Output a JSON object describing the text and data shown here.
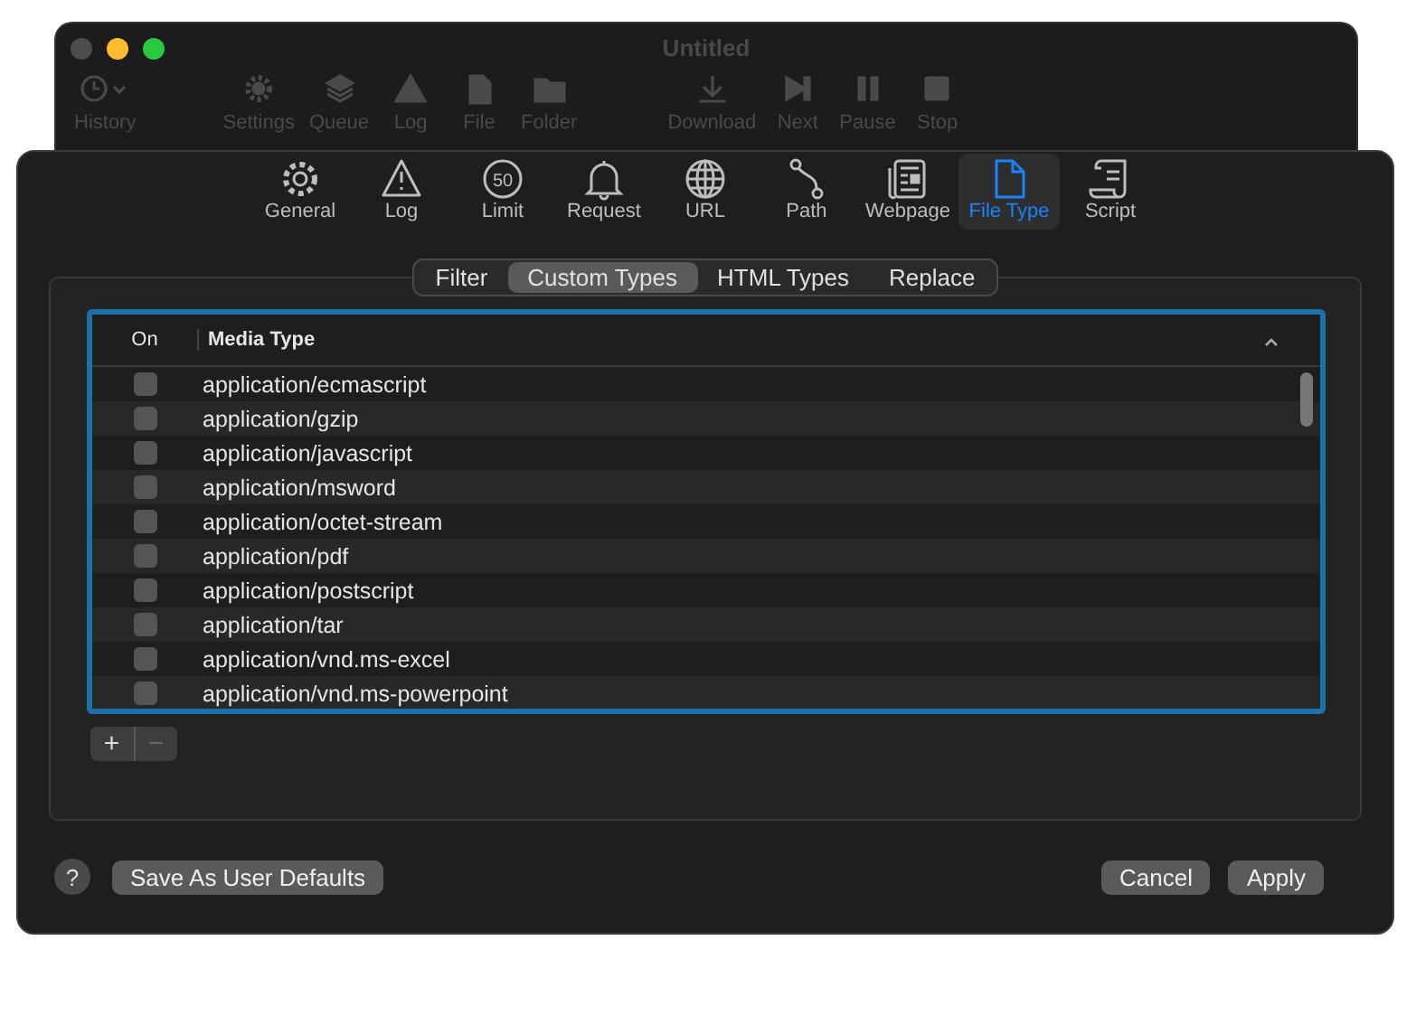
{
  "window": {
    "title": "Untitled"
  },
  "toolbar": [
    {
      "label": "History",
      "kind": "history"
    },
    {
      "label": "Settings",
      "kind": "gear"
    },
    {
      "label": "Queue",
      "kind": "stack"
    },
    {
      "label": "Log",
      "kind": "warning"
    },
    {
      "label": "File",
      "kind": "file"
    },
    {
      "label": "Folder",
      "kind": "folder"
    },
    {
      "label": "Download",
      "kind": "download"
    },
    {
      "label": "Next",
      "kind": "next"
    },
    {
      "label": "Pause",
      "kind": "pause"
    },
    {
      "label": "Stop",
      "kind": "stop"
    }
  ],
  "settings_tabs": [
    {
      "label": "General",
      "kind": "gear",
      "selected": false
    },
    {
      "label": "Log",
      "kind": "warning",
      "selected": false
    },
    {
      "label": "Limit",
      "kind": "limit",
      "icon_text": "50",
      "selected": false
    },
    {
      "label": "Request",
      "kind": "bell",
      "selected": false
    },
    {
      "label": "URL",
      "kind": "globe",
      "selected": false
    },
    {
      "label": "Path",
      "kind": "path",
      "selected": false
    },
    {
      "label": "Webpage",
      "kind": "page",
      "selected": false
    },
    {
      "label": "File Type",
      "kind": "file",
      "selected": true
    },
    {
      "label": "Script",
      "kind": "scroll",
      "selected": false
    }
  ],
  "segments": [
    {
      "label": "Filter",
      "selected": false
    },
    {
      "label": "Custom Types",
      "selected": true
    },
    {
      "label": "HTML Types",
      "selected": false
    },
    {
      "label": "Replace",
      "selected": false
    }
  ],
  "table": {
    "columns": [
      "On",
      "Media Type"
    ],
    "rows": [
      {
        "checked": false,
        "media_type": "application/ecmascript"
      },
      {
        "checked": false,
        "media_type": "application/gzip"
      },
      {
        "checked": false,
        "media_type": "application/javascript"
      },
      {
        "checked": false,
        "media_type": "application/msword"
      },
      {
        "checked": false,
        "media_type": "application/octet-stream"
      },
      {
        "checked": false,
        "media_type": "application/pdf"
      },
      {
        "checked": false,
        "media_type": "application/postscript"
      },
      {
        "checked": false,
        "media_type": "application/tar"
      },
      {
        "checked": false,
        "media_type": "application/vnd.ms-excel"
      },
      {
        "checked": false,
        "media_type": "application/vnd.ms-powerpoint"
      }
    ]
  },
  "list_buttons": [
    "+",
    "−"
  ],
  "help": "?",
  "footer_buttons": {
    "left": "Save As User Defaults",
    "cancel": "Cancel",
    "apply": "Apply"
  }
}
